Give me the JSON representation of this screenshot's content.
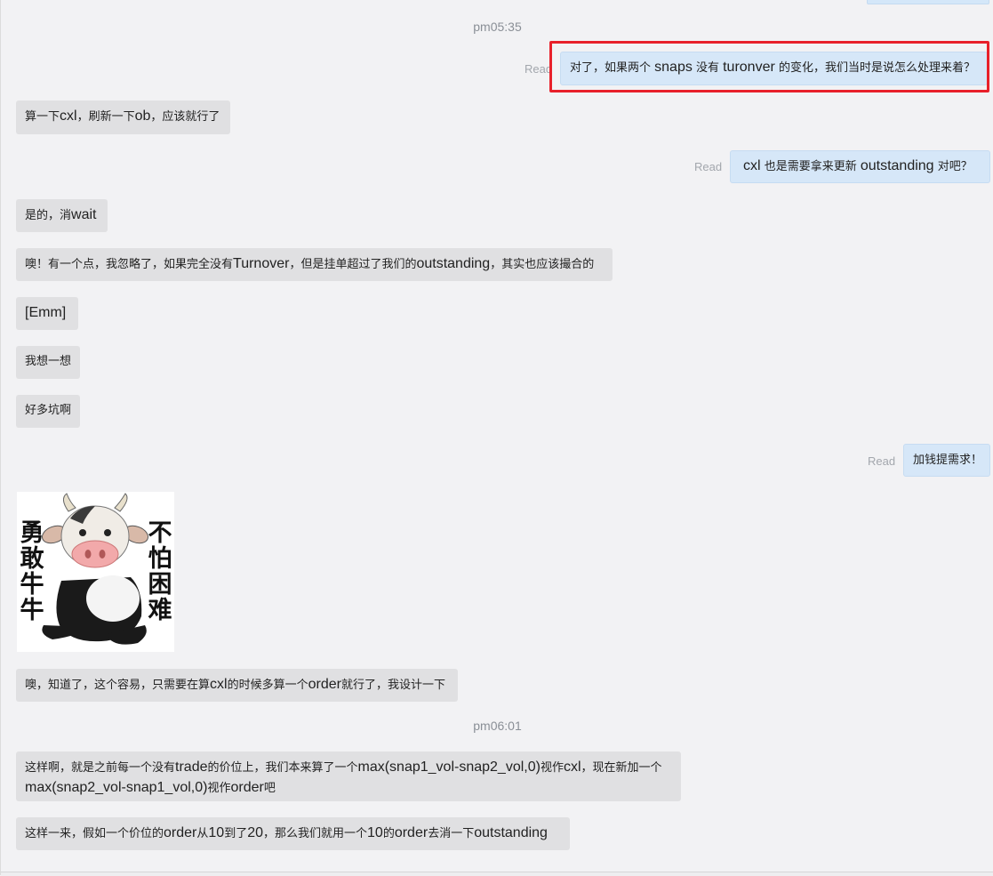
{
  "timestamps": [
    "pm05:35",
    "pm06:01"
  ],
  "read_label": "Read",
  "messages": {
    "m1_right": {
      "parts": [
        "对了，如果两个 ",
        "snaps",
        " 没有 ",
        "turonver",
        " 的变化，我们当时是说怎么处理来着？"
      ]
    },
    "m2_left": {
      "parts": [
        "算一下",
        "cxl",
        "，刷新一下",
        "ob",
        "，应该就行了"
      ]
    },
    "m3_right": {
      "parts": [
        "cxl",
        " 也是需要拿来更新 ",
        "outstanding",
        " 对吧？"
      ]
    },
    "m4_left": {
      "parts": [
        "是的，消",
        "wait"
      ]
    },
    "m5_left": {
      "parts": [
        "噢！有一个点，我忽略了，如果完全没有",
        "Turnover",
        "，但是挂单超过了我们的",
        "outstanding",
        "，其实也应该撮合的"
      ]
    },
    "m6_left": {
      "text": "[Emm]"
    },
    "m7_left": {
      "text": "我想一想"
    },
    "m8_left": {
      "text": "好多坑啊"
    },
    "m9_right": {
      "text": "加钱提需求！"
    },
    "sticker": {
      "left_text": [
        "勇",
        "敢",
        "牛",
        "牛"
      ],
      "right_text": [
        "不",
        "怕",
        "困",
        "难"
      ]
    },
    "m10_left": {
      "parts": [
        "噢，知道了，这个容易，只需要在算",
        "cxl",
        "的时候多算一个",
        "order",
        "就行了，我设计一下"
      ]
    },
    "m11_left": {
      "line1": [
        "这样啊，就是之前每一个没有",
        "trade",
        "的价位上，我们本来算了一个",
        "max(snap1_vol-snap2_vol,0)",
        "视作",
        "cxl",
        "，现在新加一个"
      ],
      "line2": [
        "max(snap2_vol-snap1_vol,0)",
        "视作",
        "order",
        "吧"
      ]
    },
    "m12_left": {
      "parts": [
        "这样一来，假如一个价位的",
        "order",
        "从",
        "10",
        "到了",
        "20",
        "，那么我们就用一个",
        "10",
        "的",
        "order",
        "去消一下",
        "outstanding"
      ]
    }
  },
  "colors": {
    "left_bubble": "#e0e0e2",
    "right_bubble": "#d6e7f8",
    "highlight": "#e8202a",
    "background": "#f2f2f4"
  }
}
